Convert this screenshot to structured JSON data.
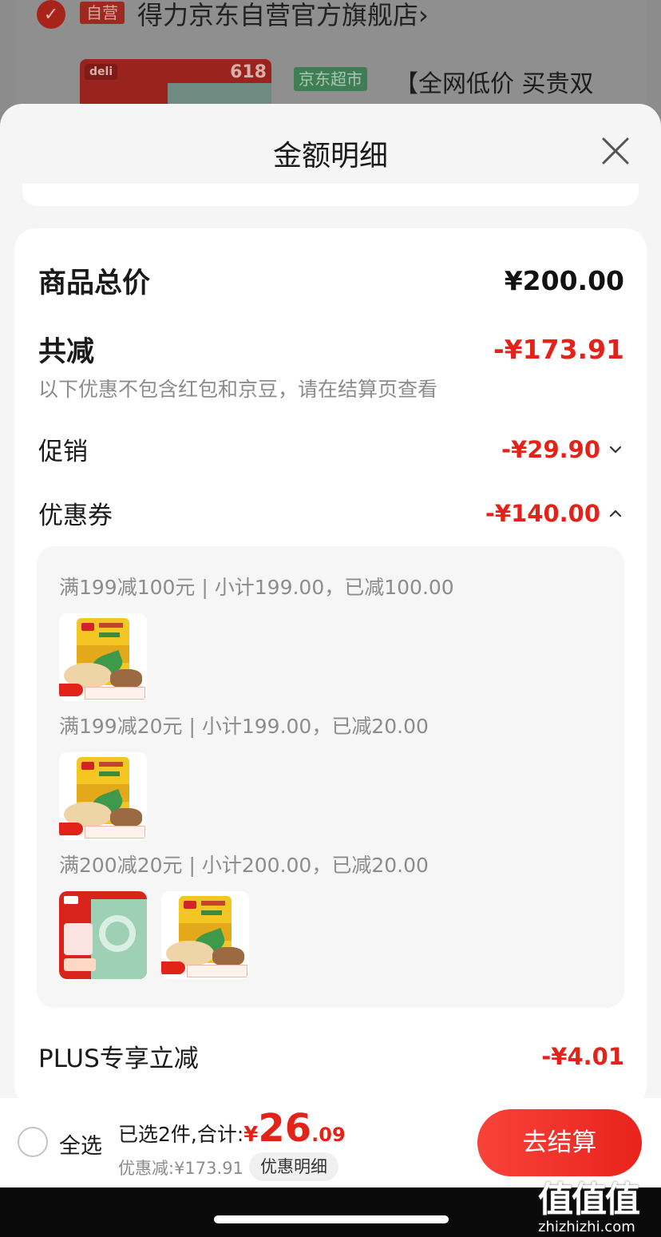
{
  "background": {
    "self_badge": "自营",
    "store_name": "得力京东自营官方旗舰店",
    "store_chevron": "›",
    "product_thumb_brand": "deli",
    "product_thumb_promo": "618",
    "product_tag": "京东超市",
    "product_title": "【全网低价 买贵双"
  },
  "sheet": {
    "title": "金额明细"
  },
  "detail": {
    "total_label": "商品总价",
    "total_value": "¥200.00",
    "reduce_label": "共减",
    "reduce_value": "-¥173.91",
    "reduce_note": "以下优惠不包含红包和京豆，请在结算页查看",
    "promo_label": "促销",
    "promo_value": "-¥29.90",
    "coupon_label": "优惠券",
    "coupon_value": "-¥140.00",
    "coupons": [
      {
        "text": "满199减100元 | 小计199.00，已减100.00"
      },
      {
        "text": "满199减20元 | 小计199.00，已减20.00"
      },
      {
        "text": "满200减20元 | 小计200.00，已减20.00"
      }
    ],
    "plus_label": "PLUS专享立减",
    "plus_value": "-¥4.01"
  },
  "bottom": {
    "select_all": "全选",
    "summary_text": "已选2件,合计:",
    "currency": "¥",
    "total_int": "26",
    "total_dec": ".09",
    "discount_line": "优惠减:¥173.91",
    "detail_button": "优惠明细",
    "checkout_button": "去结算"
  },
  "watermark": {
    "chars": "值值值",
    "url": "zhizhizhi.com"
  },
  "colors": {
    "accent_red": "#e2231a",
    "muted_text": "#8c8c8c",
    "jd_supermarket_green": "#3f7d55"
  }
}
